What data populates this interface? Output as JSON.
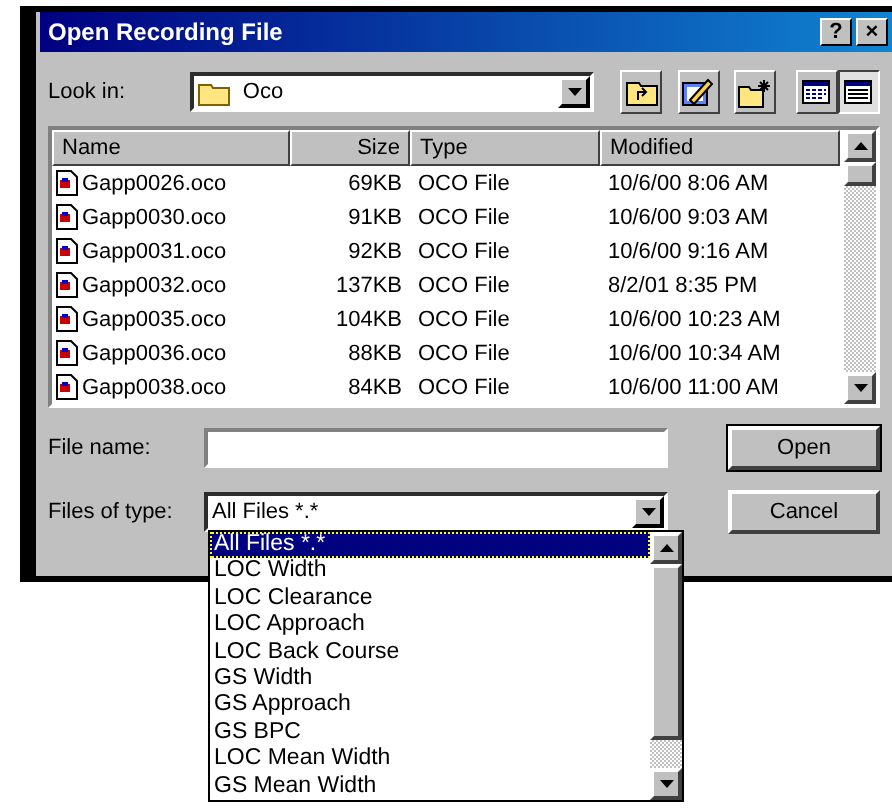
{
  "window": {
    "title": "Open Recording File",
    "buttons": [
      "?",
      "×"
    ]
  },
  "look_in": {
    "label": "Look in:",
    "value": "Oco"
  },
  "view_buttons": [
    {
      "selected": false
    },
    {
      "selected": true
    }
  ],
  "table": {
    "columns": [
      "Name",
      "Size",
      "Type",
      "Modified"
    ],
    "rows": [
      {
        "name": "Gapp0026.oco",
        "size": "69KB",
        "type": "OCO File",
        "modified": "10/6/00 8:06 AM"
      },
      {
        "name": "Gapp0030.oco",
        "size": "91KB",
        "type": "OCO File",
        "modified": "10/6/00 9:03 AM"
      },
      {
        "name": "Gapp0031.oco",
        "size": "92KB",
        "type": "OCO File",
        "modified": "10/6/00 9:16 AM"
      },
      {
        "name": "Gapp0032.oco",
        "size": "137KB",
        "type": "OCO File",
        "modified": "8/2/01 8:35 PM"
      },
      {
        "name": "Gapp0035.oco",
        "size": "104KB",
        "type": "OCO File",
        "modified": "10/6/00 10:23 AM"
      },
      {
        "name": "Gapp0036.oco",
        "size": "88KB",
        "type": "OCO File",
        "modified": "10/6/00 10:34 AM"
      },
      {
        "name": "Gapp0038.oco",
        "size": "84KB",
        "type": "OCO File",
        "modified": "10/6/00 11:00 AM"
      }
    ]
  },
  "file_name": {
    "label": "File name:"
  },
  "file_type": {
    "label": "Files of type:",
    "value": "All Files *.*"
  },
  "buttons": [
    "Open",
    "Cancel"
  ],
  "type_options": [
    {
      "label": "All Files *.*",
      "selected": true
    },
    {
      "label": "LOC Width",
      "selected": false
    },
    {
      "label": "LOC Clearance",
      "selected": false
    },
    {
      "label": "LOC Approach",
      "selected": false
    },
    {
      "label": "LOC Back Course",
      "selected": false
    },
    {
      "label": "GS Width",
      "selected": false
    },
    {
      "label": "GS Approach",
      "selected": false
    },
    {
      "label": "GS BPC",
      "selected": false
    },
    {
      "label": "LOC Mean Width",
      "selected": false
    },
    {
      "label": "GS Mean Width",
      "selected": false
    }
  ]
}
